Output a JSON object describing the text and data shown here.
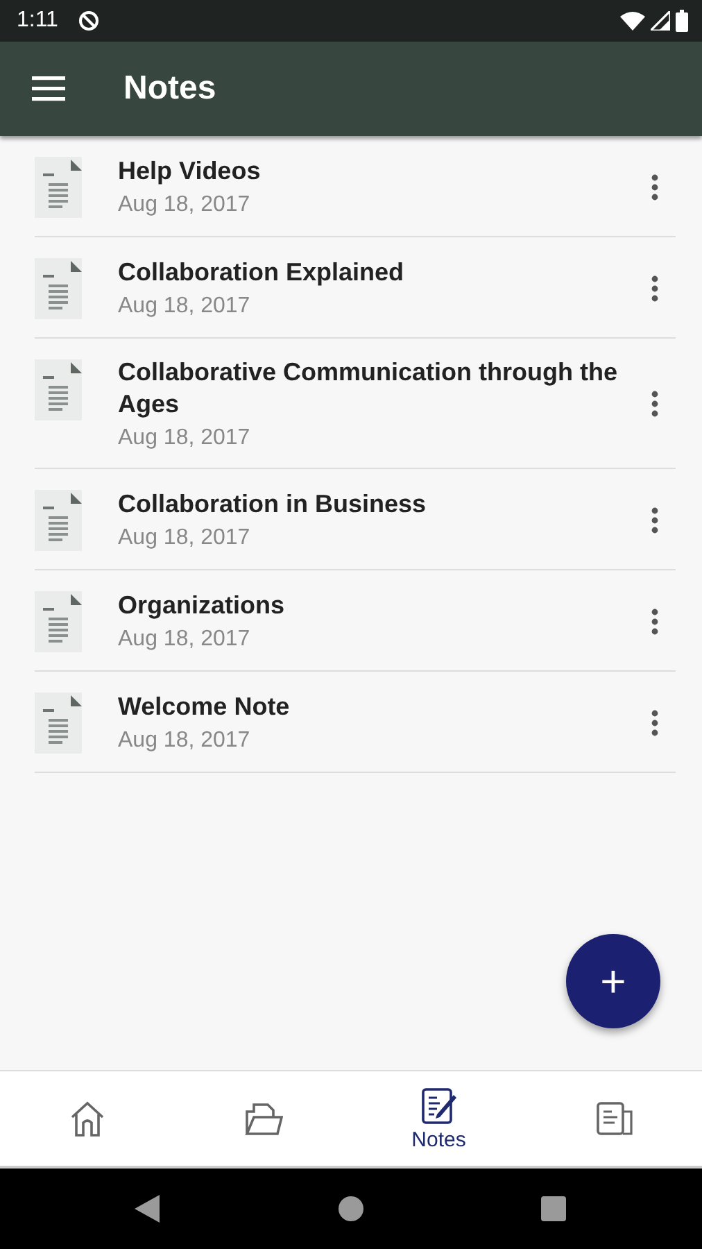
{
  "status_bar": {
    "time": "1:11"
  },
  "app_bar": {
    "title": "Notes"
  },
  "notes": [
    {
      "title": "Help Videos",
      "date": "Aug 18, 2017"
    },
    {
      "title": "Collaboration Explained",
      "date": "Aug 18, 2017"
    },
    {
      "title": "Collaborative Communication through the Ages",
      "date": "Aug 18, 2017"
    },
    {
      "title": "Collaboration in Business",
      "date": "Aug 18, 2017"
    },
    {
      "title": "Organizations",
      "date": "Aug 18, 2017"
    },
    {
      "title": "Welcome Note",
      "date": "Aug 18, 2017"
    }
  ],
  "fab": {
    "label": "+"
  },
  "bottom_nav": [
    {
      "kind": "home",
      "selected": false
    },
    {
      "kind": "folder",
      "selected": false
    },
    {
      "kind": "notes",
      "label": "Notes",
      "selected": true
    },
    {
      "kind": "reader",
      "selected": false
    }
  ]
}
